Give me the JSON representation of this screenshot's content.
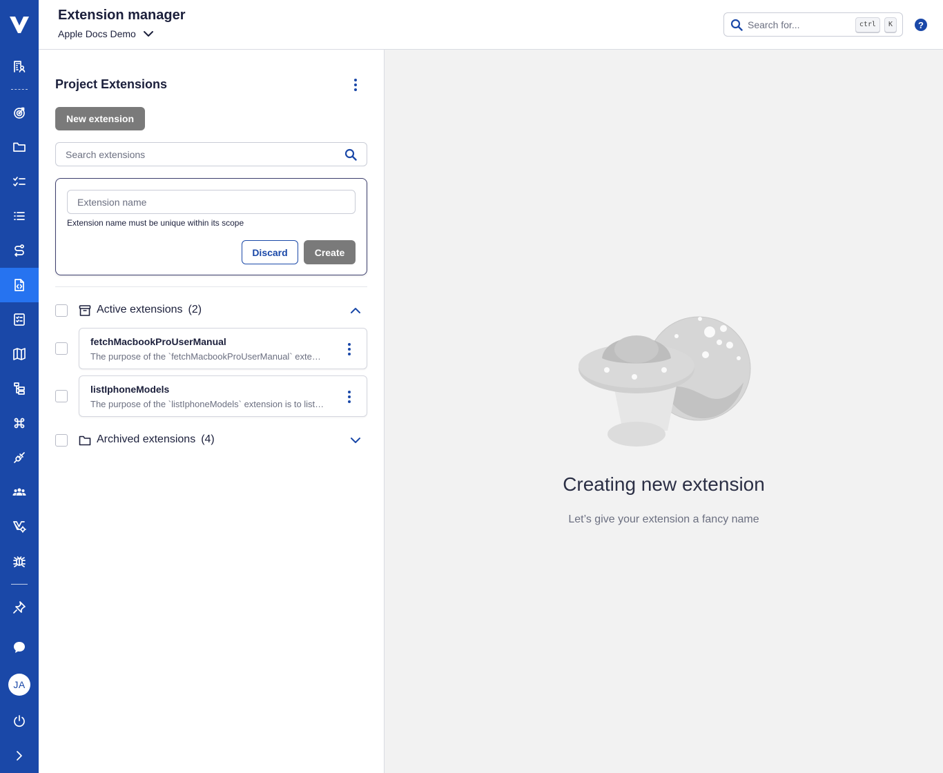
{
  "header": {
    "title": "Extension manager",
    "project": "Apple Docs Demo",
    "search_placeholder": "Search for...",
    "shortcut_ctrl": "ctrl",
    "shortcut_key": "K",
    "help": "?"
  },
  "sidebar": {
    "avatar_initials": "JA",
    "active_item": "extensions"
  },
  "panel": {
    "title": "Project Extensions",
    "new_button": "New extension",
    "search_placeholder": "Search extensions",
    "new_form": {
      "name_placeholder": "Extension name",
      "hint": "Extension name must be unique within its scope",
      "discard": "Discard",
      "create": "Create"
    },
    "groups": [
      {
        "label": "Active extensions",
        "count": "(2)",
        "expanded": true,
        "items": [
          {
            "name": "fetchMacbookProUserManual",
            "description": "The purpose of the `fetchMacbookProUserManual` extension is to retrieve the user manual"
          },
          {
            "name": "listIphoneModels",
            "description": "The purpose of the `listIphoneModels` extension is to list the available iPhone models"
          }
        ]
      },
      {
        "label": "Archived extensions",
        "count": "(4)",
        "expanded": false
      }
    ]
  },
  "main": {
    "empty_title": "Creating new extension",
    "empty_subtitle": "Let’s give your extension a fancy name"
  },
  "colors": {
    "rail": "#1a48a8",
    "rail_active": "#2673f0",
    "accent": "#1a48a8",
    "disabled_button": "#7a7a7a",
    "main_bg": "#f2f2f2"
  }
}
